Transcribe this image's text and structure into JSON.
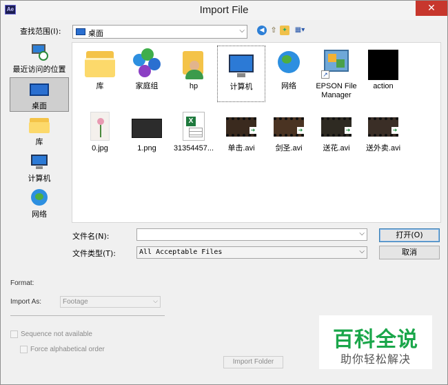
{
  "window": {
    "title": "Import File",
    "app_badge": "Ae",
    "close_glyph": "✕"
  },
  "toolbar": {
    "look_in_label": "查找范围(I):",
    "look_in_value": "桌面",
    "icons": [
      "back-icon",
      "up-folder-icon",
      "new-folder-icon",
      "view-menu-icon"
    ]
  },
  "places": [
    {
      "label": "最近访问的位置",
      "icon": "recent-places-icon"
    },
    {
      "label": "桌面",
      "icon": "desktop-icon",
      "selected": true
    },
    {
      "label": "库",
      "icon": "libraries-icon"
    },
    {
      "label": "计算机",
      "icon": "computer-icon"
    },
    {
      "label": "网络",
      "icon": "network-icon"
    }
  ],
  "files": [
    {
      "name": "库",
      "icon": "libraries-folder-icon"
    },
    {
      "name": "家庭组",
      "icon": "homegroup-icon"
    },
    {
      "name": "hp",
      "icon": "user-folder-icon"
    },
    {
      "name": "计算机",
      "icon": "computer-icon",
      "focused": true
    },
    {
      "name": "网络",
      "icon": "network-icon"
    },
    {
      "name": "EPSON File Manager",
      "icon": "epson-shortcut-icon"
    },
    {
      "name": "action",
      "icon": "black-image-icon"
    },
    {
      "name": "0.jpg",
      "icon": "jpg-thumbnail-icon"
    },
    {
      "name": "1.png",
      "icon": "png-thumbnail-icon"
    },
    {
      "name": "31354457...",
      "icon": "excel-file-icon"
    },
    {
      "name": "单击.avi",
      "icon": "video-file-icon"
    },
    {
      "name": "剑圣.avi",
      "icon": "video-file-icon"
    },
    {
      "name": "送花.avi",
      "icon": "video-file-icon"
    },
    {
      "name": "送外卖.avi",
      "icon": "video-file-icon"
    }
  ],
  "filename": {
    "label": "文件名(N):",
    "value": ""
  },
  "filetype": {
    "label": "文件类型(T):",
    "value": "All Acceptable Files"
  },
  "buttons": {
    "open": "打开(O)",
    "cancel": "取消"
  },
  "ae_options": {
    "format_label": "Format:",
    "import_as_label": "Import As:",
    "import_as_value": "Footage",
    "sequence_label": "Sequence not available",
    "alpha_label": "Force alphabetical order",
    "import_folder_label": "Import Folder"
  },
  "watermark": {
    "main": "百科全说",
    "sub": "助你轻松解决"
  }
}
